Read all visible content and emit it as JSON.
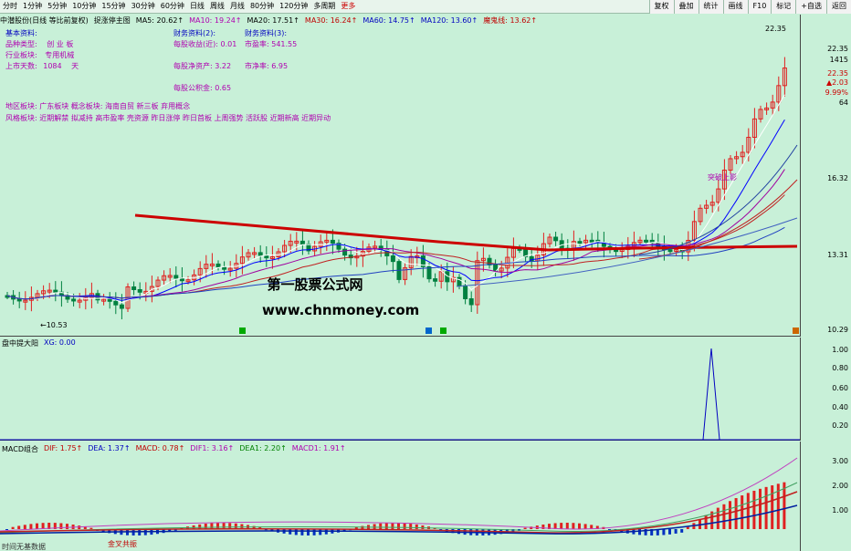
{
  "toolbar": {
    "periods": [
      "分时",
      "1分钟",
      "5分钟",
      "10分钟",
      "15分钟",
      "30分钟",
      "60分钟",
      "日线",
      "周线",
      "月线",
      "80分钟",
      "120分钟",
      "多周期"
    ],
    "more_label": "更多",
    "right_buttons": [
      "复权",
      "叠加",
      "统计",
      "画线",
      "F10",
      "标记",
      "+自选",
      "返回"
    ]
  },
  "main_indicator": {
    "stock_name": "中潜股份(日线 等比前复权)",
    "formula": "捉涨停主图",
    "ma5": "MA5: 20.62↑",
    "ma10": "MA10: 19.24↑",
    "ma20": "MA20: 17.51↑",
    "ma30": "MA30: 16.24↑",
    "ma60": "MA60: 14.75↑",
    "ma120": "MA120: 13.60↑",
    "mogui": "魔鬼线: 13.62↑"
  },
  "info": {
    "basic_title": "基本资料:",
    "category_label": "品种类型:",
    "category_value": "创 业 板",
    "industry_label": "行业板块:",
    "industry_value": "专用机械",
    "days_label": "上市天数:",
    "days_value": "1084",
    "days_unit": "天",
    "fin2_title": "财务资料(2):",
    "eps": "每股收益(近): 0.01",
    "nav": "每股净资产:   3.22",
    "fund": "每股公积金:   0.65",
    "fin3_title": "财务资料(3):",
    "pe": "市盈率:   541.55",
    "pb": "市净率:     6.95",
    "region_line": "地区板块: 广东板块     概念板块: 海南自贸 新三板 弃用概念",
    "style_line": "风格板块: 近期解禁 拟减持 高市盈率 壳资源 昨日涨停 昨日首板 上周强势 活跃股 近期新高 近期异动"
  },
  "main_axis": {
    "labels": [
      "22.35",
      "1415",
      "22.35",
      "▲2.03",
      "9.99%",
      "64",
      "16.32",
      "13.31",
      "10.29"
    ]
  },
  "annotations": {
    "high_price": "22.35",
    "low_price": "←10.53",
    "breakout": "突破上影",
    "watermark1": "第一股票公式网",
    "watermark2": "www.chnmoney.com"
  },
  "sub1": {
    "title": "盘中提大阳",
    "value": "XG: 0.00",
    "axis": [
      "1.00",
      "0.80",
      "0.60",
      "0.40",
      "0.20"
    ]
  },
  "sub2": {
    "title": "MACD组合",
    "dif": "DIF: 1.75↑",
    "dea": "DEA: 1.37↑",
    "macd": "MACD: 0.78↑",
    "dif1": "DIF1: 3.16↑",
    "dea1": "DEA1: 2.20↑",
    "macd1": "MACD1: 1.91↑",
    "axis": [
      "3.00",
      "2.00",
      "1.00"
    ],
    "golden_cross": "金叉共振",
    "bottom_text": "时间无基数据"
  },
  "colors": {
    "bg": "#c8f0d8",
    "up": "#e02020",
    "down": "#008040",
    "ma5": "#ffffff",
    "ma10": "#0000ff",
    "mogui": "#cc0000"
  }
}
